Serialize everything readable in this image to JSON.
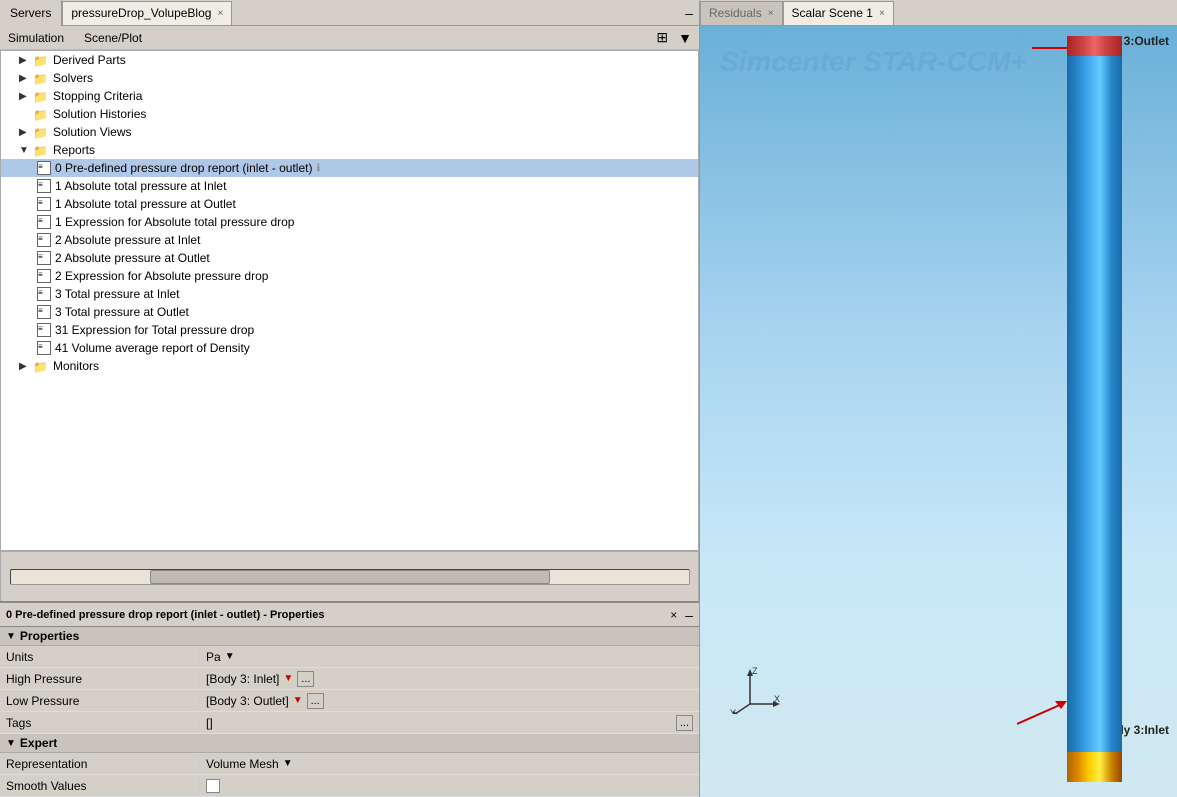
{
  "tabs": {
    "servers_label": "Servers",
    "main_tab_label": "pressureDrop_VolupeBlog",
    "residuals_tab": "Residuals",
    "scalar_scene_tab": "Scalar Scene 1"
  },
  "menu": {
    "simulation_label": "Simulation",
    "scene_plot_label": "Scene/Plot"
  },
  "tree": {
    "derived_parts": "Derived Parts",
    "solvers": "Solvers",
    "stopping_criteria": "Stopping Criteria",
    "solution_histories": "Solution Histories",
    "solution_views": "Solution Views",
    "reports": "Reports",
    "monitors": "Monitors",
    "reports_items": [
      "0 Pre-defined pressure drop report (inlet - outlet)",
      "1 Absolute total pressure at Inlet",
      "1 Absolute total pressure at Outlet",
      "1 Expression for Absolute total pressure drop",
      "2 Absolute pressure at Inlet",
      "2 Absolute pressure at Outlet",
      "2 Expression for Absolute pressure drop",
      "3 Total pressure at Inlet",
      "3 Total pressure at Outlet",
      "31 Expression for Total pressure drop",
      "41 Volume average report of Density"
    ]
  },
  "properties": {
    "title": "0 Pre-defined pressure drop report (inlet - outlet) - Properties",
    "sections": {
      "properties_label": "Properties",
      "expert_label": "Expert"
    },
    "rows": {
      "units_label": "Units",
      "units_value": "Pa",
      "high_pressure_label": "High Pressure",
      "high_pressure_value": "[Body 3: Inlet]",
      "low_pressure_label": "Low Pressure",
      "low_pressure_value": "[Body 3: Outlet]",
      "tags_label": "Tags",
      "tags_value": "[]",
      "representation_label": "Representation",
      "representation_value": "Volume Mesh",
      "smooth_values_label": "Smooth Values"
    }
  },
  "scene": {
    "brand": "Simcenter STAR-CCM+",
    "body3_outlet": "Body 3:Outlet",
    "body3_inlet": "Body 3:Inlet",
    "axis_z": "Z",
    "axis_y": "Y",
    "axis_x": "X"
  }
}
